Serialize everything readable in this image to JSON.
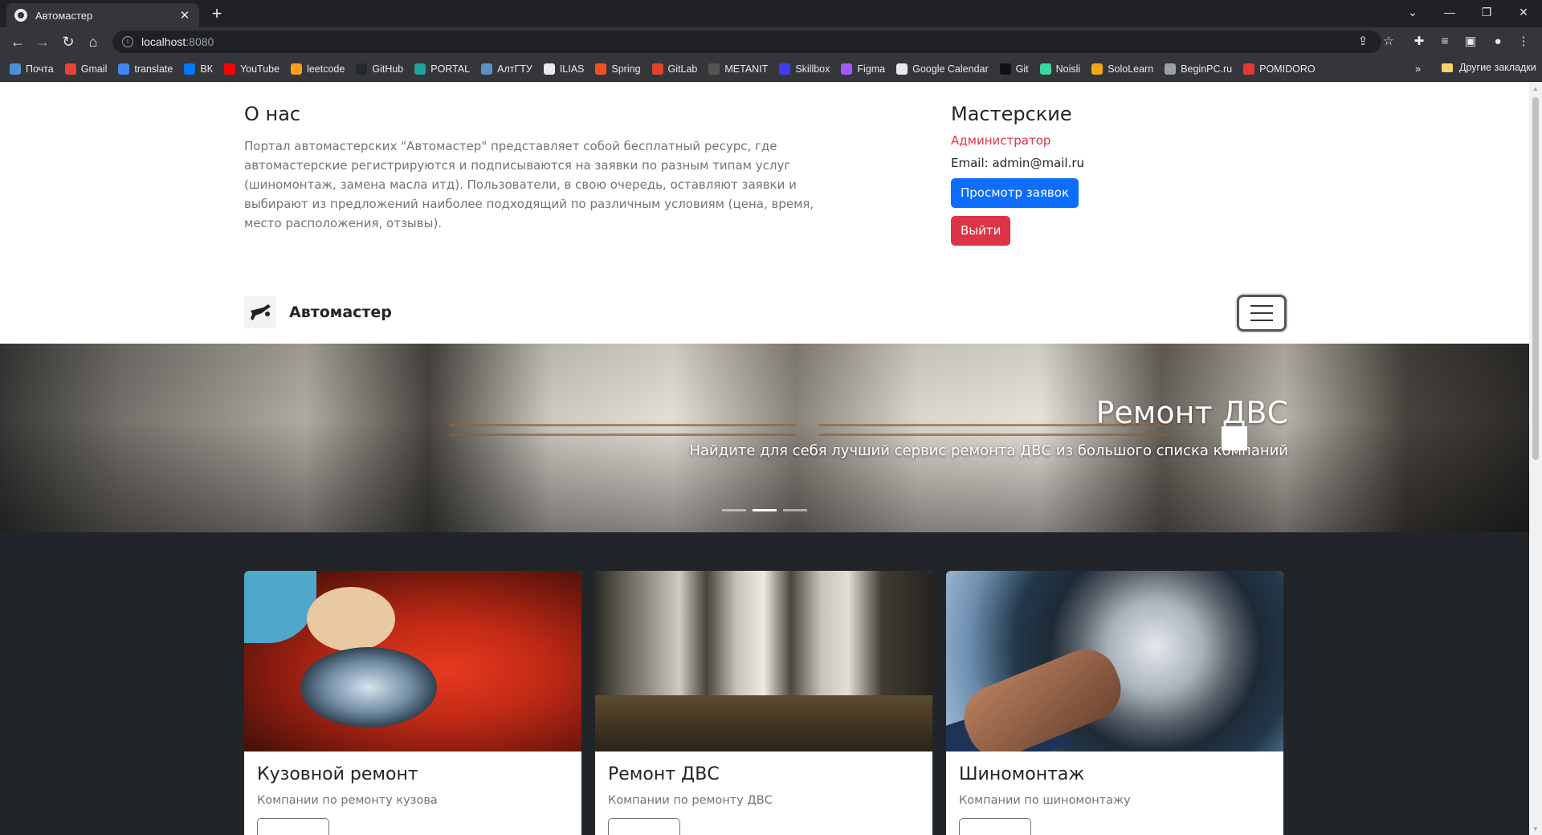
{
  "browser": {
    "tab_title": "Автомастер",
    "tab_close": "✕",
    "new_tab": "+",
    "url_host": "localhost",
    "url_port": ":8080",
    "window_controls": [
      "⌄",
      "—",
      "❐",
      "✕"
    ],
    "bookmarks": [
      {
        "label": "Почта",
        "color": "#4a90d9"
      },
      {
        "label": "Gmail",
        "color": "#ea4335"
      },
      {
        "label": "translate",
        "color": "#4285f4"
      },
      {
        "label": "ВК",
        "color": "#0077ff"
      },
      {
        "label": "YouTube",
        "color": "#ff0000"
      },
      {
        "label": "leetcode",
        "color": "#f89f1b"
      },
      {
        "label": "GitHub",
        "color": "#24292e"
      },
      {
        "label": "PORTAL",
        "color": "#20a39e"
      },
      {
        "label": "АлтГТУ",
        "color": "#5a8fc9"
      },
      {
        "label": "ILIAS",
        "color": "#e8eaed"
      },
      {
        "label": "Spring",
        "color": "#f4511e"
      },
      {
        "label": "GitLab",
        "color": "#e24329"
      },
      {
        "label": "METANIT",
        "color": "#555555"
      },
      {
        "label": "Skillbox",
        "color": "#3f3cf5"
      },
      {
        "label": "Figma",
        "color": "#a259ff"
      },
      {
        "label": "Google Calendar",
        "color": "#e8eaed"
      },
      {
        "label": "Git",
        "color": "#111111"
      },
      {
        "label": "Noisli",
        "color": "#3dd6a0"
      },
      {
        "label": "SoloLearn",
        "color": "#f0a51d"
      },
      {
        "label": "BeginPC.ru",
        "color": "#9aa0a6"
      },
      {
        "label": "POMIDORO",
        "color": "#e53935"
      }
    ],
    "bookmarks_more": "»",
    "other_bookmarks": "Другие закладки"
  },
  "about": {
    "title": "О нас",
    "text": "Портал автомастерских \"Автомастер\" представляет собой бесплатный ресурс, где автомастерские регистрируются и подписываются на заявки по разным типам услуг (шиномонтаж, замена масла итд). Пользователи, в свою очередь, оставляют заявки и выбирают из предложений наиболее подходящий по различным условиям (цена, время, место расположения, отзывы)."
  },
  "workshops": {
    "title": "Мастерские",
    "role": "Администратор",
    "email": "Email: admin@mail.ru",
    "view_requests": "Просмотр заявок",
    "logout": "Выйти"
  },
  "navbar": {
    "brand": "Автомастер"
  },
  "carousel": {
    "title": "Ремонт ДВС",
    "text": "Найдите для себя лучший сервис ремонта ДВС из большого списка компаний",
    "active_index": 1,
    "count": 3
  },
  "cards": [
    {
      "title": "Кузовной ремонт",
      "text": "Компании по ремонту кузова"
    },
    {
      "title": "Ремонт ДВС",
      "text": "Компании по ремонту ДВС"
    },
    {
      "title": "Шиномонтаж",
      "text": "Компании по шиномонтажу"
    }
  ],
  "colors": {
    "primary": "#0d6efd",
    "danger": "#dc3545",
    "dark_section": "#212529"
  }
}
